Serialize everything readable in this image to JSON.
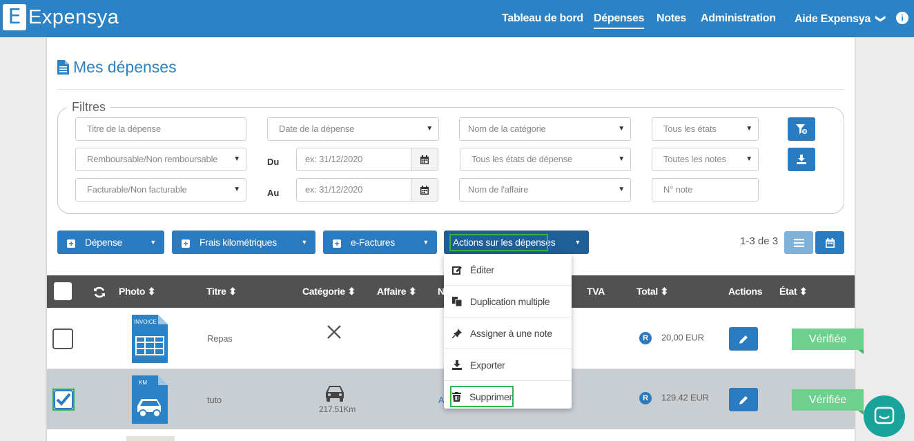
{
  "brand": {
    "logo_letter": "E",
    "name": "Expensya"
  },
  "nav": {
    "items": [
      "Tableau de bord",
      "Dépenses",
      "Notes",
      "Administration",
      "Aide Expensya"
    ],
    "active": "Dépenses",
    "help_caret": "❯",
    "info_icon": "i"
  },
  "page": {
    "title": "Mes dépenses"
  },
  "filters": {
    "legend": "Filtres",
    "title_placeholder": "Titre de la dépense",
    "date_select": "Date de la dépense",
    "category_select": "Nom de la catégorie",
    "states_select": "Tous les états",
    "reimbursable_select": "Remboursable/Non remboursable",
    "from_label": "Du",
    "from_placeholder": "ex: 31/12/2020",
    "expense_states_select": "Tous les états de dépense",
    "notes_select": "Toutes les notes",
    "billable_select": "Facturable/Non facturable",
    "to_label": "Au",
    "to_placeholder": "ex: 31/12/2020",
    "business_select": "Nom de l'affaire",
    "note_number_placeholder": "N° note"
  },
  "toolbar": {
    "expense_button": "Dépense",
    "mileage_button": "Frais kilométriques",
    "einvoices_button": "e-Factures",
    "actions_button": "Actions sur les dépenses",
    "count": "1-3 de 3"
  },
  "actions_menu": [
    {
      "label": "Éditer",
      "icon": "edit-icon"
    },
    {
      "label": "Duplication multiple",
      "icon": "copy-icon"
    },
    {
      "label": "Assigner à une note",
      "icon": "pin-icon"
    },
    {
      "label": "Exporter",
      "icon": "download-icon"
    },
    {
      "label": "Supprimer",
      "icon": "trash-icon"
    }
  ],
  "table": {
    "headers": {
      "photo": "Photo",
      "title": "Titre",
      "category": "Catégorie",
      "business": "Affaire",
      "note_partial": "N",
      "vat": "TVA",
      "total": "Total",
      "actions": "Actions",
      "state": "État"
    },
    "sort_glyph": "⬍",
    "rows": [
      {
        "thumb_label": "INVOICE",
        "title": "Repas",
        "category_icon": "utensils-icon",
        "category_sub": "",
        "business_partial": "",
        "reimb_glyph": "R",
        "total": "20,00 EUR",
        "state": "Vérifiée",
        "checked": false
      },
      {
        "thumb_label": "KM",
        "title": "tuto",
        "category_icon": "car-icon",
        "category_sub": "217.51Km",
        "business_partial": "A",
        "reimb_glyph": "R",
        "total": "129.42 EUR",
        "state": "Vérifiée",
        "checked": true
      }
    ]
  },
  "colors": {
    "brand_blue": "#2b82c4",
    "button_blue": "#2b7bc0",
    "header_dark": "#515151",
    "verified_green": "#6dd08d",
    "highlight_green": "#2fb54a",
    "chat_teal": "#18a39b",
    "selected_row": "#c9ced3"
  }
}
